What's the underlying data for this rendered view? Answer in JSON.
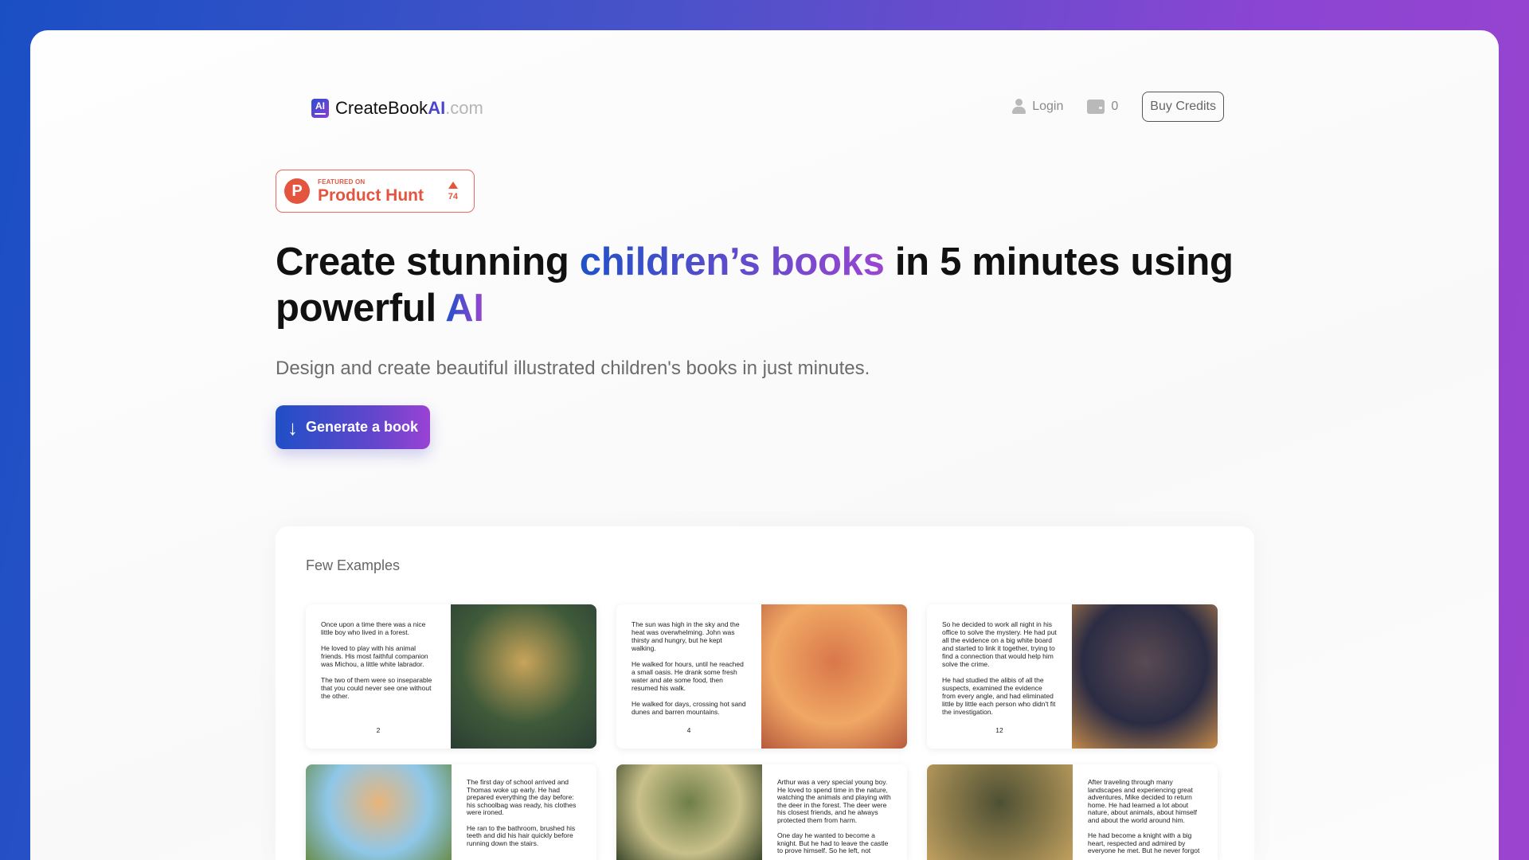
{
  "header": {
    "logo_icon": "AI",
    "logo_main": "CreateBook",
    "logo_ai": "AI",
    "logo_domain": ".com",
    "login": "Login",
    "credits": "0",
    "buy_credits": "Buy Credits"
  },
  "badge": {
    "featured": "FEATURED ON",
    "name": "Product Hunt",
    "votes": "74"
  },
  "hero": {
    "h1_part1": "Create stunning ",
    "h1_highlight": "children’s books",
    "h1_part2": " in 5 minutes using powerful ",
    "h1_ai": "AI",
    "subtitle": "Design and create beautiful illustrated children's books in just minutes.",
    "cta": "Generate a book"
  },
  "examples": {
    "title": "Few Examples",
    "cards": [
      {
        "text": [
          "Once upon a time there was a nice little boy who lived in a forest.",
          "He loved to play with his animal friends. His most faithful companion was Michou, a little white labrador.",
          "The two of them were so inseparable that you could never see one without the other."
        ],
        "page": "2",
        "image": "boy-with-dog-in-forest",
        "colors": [
          "#3f5a3a",
          "#c9a45a",
          "#2b3d33"
        ]
      },
      {
        "text": [
          "The sun was high in the sky and the heat was overwhelming. John was thirsty and hungry, but he kept walking.",
          "He walked for hours, until he reached a small oasis. He drank some fresh water and ate some food, then resumed his walk.",
          "He walked for days, crossing hot sand dunes and barren mountains."
        ],
        "page": "4",
        "image": "boy-in-desert",
        "colors": [
          "#f0a865",
          "#d9774a",
          "#b85a3c"
        ]
      },
      {
        "text": [
          "So he decided to work all night in his office to solve the mystery. He had put all the evidence on a big white board and started to link it together, trying to find a connection that would help him solve the crime.",
          "He had studied the alibis of all the suspects, examined the evidence from every angle, and had eliminated little by little each person who didn't fit the investigation."
        ],
        "page": "12",
        "image": "detective-at-desk",
        "colors": [
          "#2b2c44",
          "#5a4a52",
          "#c58a4a"
        ]
      },
      {
        "text": [
          "The first day of school arrived and Thomas woke up early. He had prepared everything the day before: his schoolbag was ready, his clothes were ironed.",
          "He ran to the bathroom, brushed his teeth and did his hair quickly before running down the stairs."
        ],
        "page": "",
        "image": "smiling-boy",
        "colors": [
          "#8fc7e8",
          "#e9b57a",
          "#6a8e4e"
        ]
      },
      {
        "text": [
          "Arthur was a very special young boy. He loved to spend time in the nature, watching the animals and playing with the deer in the forest. The deer were his closest friends, and he always protected them from harm.",
          "One day he wanted to become a knight. But he had to leave the castle to prove himself. So he left, not"
        ],
        "page": "",
        "image": "castle-and-deer",
        "colors": [
          "#c9c08a",
          "#6f7e48",
          "#3e4a2c"
        ]
      },
      {
        "text": [
          "After traveling through many landscapes and experiencing great adventures, Mike decided to return home. He had learned a lot about nature, about animals, about himself and about the world around him.",
          "He had become a knight with a big heart, respected and admired by everyone he met. But he never forgot"
        ],
        "page": "",
        "image": "knight-with-dog",
        "colors": [
          "#8a7a4a",
          "#4e5034",
          "#c0a060"
        ]
      }
    ]
  }
}
